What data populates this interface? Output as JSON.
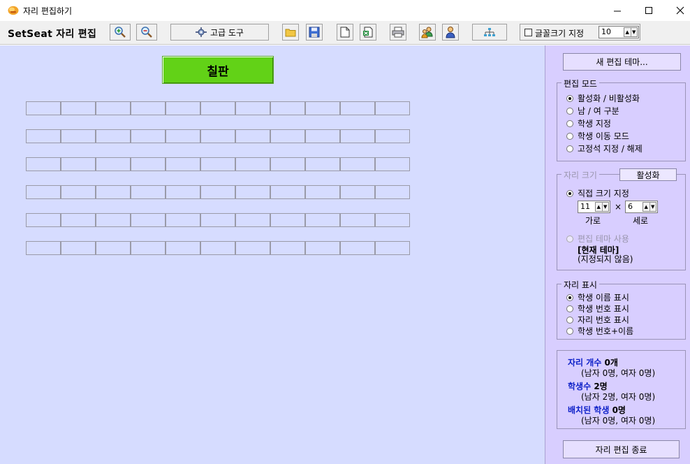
{
  "window": {
    "title": "자리 편집하기",
    "minimize_glyph": "—",
    "maximize_glyph": "☐",
    "close_glyph": "✕"
  },
  "toolbar": {
    "app_name": "SetSeat 자리 편집",
    "advanced_tools": "고급 도구",
    "font_size_label": "글꼴크기 지정",
    "font_size_value": "10"
  },
  "classroom": {
    "board_label": "칠판",
    "columns": 11,
    "rows": 6
  },
  "panel": {
    "new_theme_button": "새 편집 테마...",
    "edit_mode": {
      "title": "편집 모드",
      "options": [
        "활성화 / 비활성화",
        "남 / 여 구분",
        "학생 지정",
        "학생 이동 모드",
        "고정석 지정 / 해제"
      ],
      "selected": 0
    },
    "seat_size": {
      "title": "자리 크기",
      "activate_button": "활성화",
      "direct_label": "직접 크기 지정",
      "width_value": "11",
      "height_value": "6",
      "times": "×",
      "width_label": "가로",
      "height_label": "세로",
      "theme_label": "편집 테마 사용",
      "current_theme_label": "[현재 테마]",
      "current_theme_value": "(지정되지 않음)"
    },
    "seat_display": {
      "title": "자리 표시",
      "options": [
        "학생 이름 표시",
        "학생 번호 표시",
        "자리 번호 표시",
        "학생 번호+이름"
      ],
      "selected": 0
    },
    "stats": {
      "seat_count_label": "자리 개수",
      "seat_count_value": "0개",
      "seat_count_detail": "(남자 0명, 여자 0명)",
      "student_count_label": "학생수",
      "student_count_value": "2명",
      "student_count_detail": "(남자 2명, 여자 0명)",
      "placed_label": "배치된 학생",
      "placed_value": "0명",
      "placed_detail": "(남자 0명, 여자 0명)"
    },
    "exit_button": "자리 편집 종료"
  }
}
